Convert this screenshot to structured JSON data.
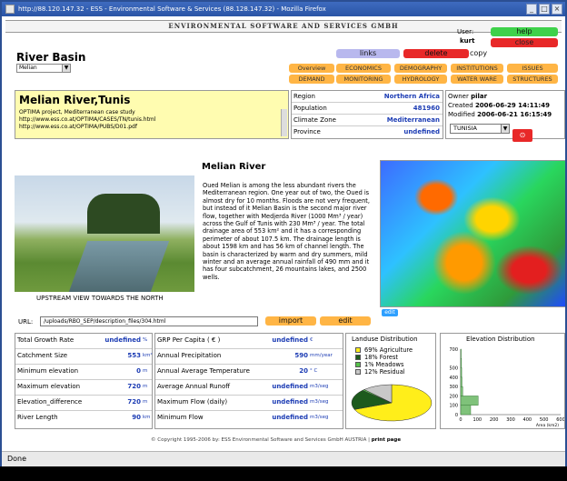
{
  "window": {
    "title": "http://88.120.147.32 - ESS - Environmental Software & Services (88.128.147.32) - Mozilla Firefox",
    "status": "Done"
  },
  "header": {
    "company": "ENVIRONMENTAL SOFTWARE AND SERVICES GMBH",
    "user_label": "User:",
    "user": "kurt"
  },
  "buttons": {
    "help": "help",
    "close": "close",
    "links": "links",
    "delete": "delete",
    "copy": "copy",
    "save": "save",
    "import": "import",
    "edit": "edit",
    "map_edit": "edit"
  },
  "page": {
    "title": "River Basin",
    "basin_select": "Melian"
  },
  "nav": {
    "row1": [
      "Overview",
      "ECONOMICS",
      "DEMOGRAPHY",
      "INSTITUTIONS",
      "ISSUES"
    ],
    "row2": [
      "DEMAND",
      "MONITORING",
      "HYDROLOGY",
      "WATER WARE",
      "STRUCTURES"
    ]
  },
  "basin": {
    "name": "Melian River,Tunis",
    "desc_lines": [
      "OPTIMA project, Mediterranean case study",
      "http://www.ess.co.at/OPTIMA/CASES/TN/tunis.html",
      "http://www.ess.co.at/OPTIMA/PUBS/D01.pdf"
    ],
    "info": [
      {
        "label": "Region",
        "value": "Northern Africa"
      },
      {
        "label": "Population",
        "value": "481960"
      },
      {
        "label": "Climate Zone",
        "value": "Mediterranean"
      },
      {
        "label": "Province",
        "value": "undefined"
      }
    ],
    "owner_label": "Owner",
    "owner": "pilar",
    "created_label": "Created",
    "created": "2006-06-29 14:11:49",
    "modified_label": "Modified",
    "modified": "2006-06-21 16:15:49",
    "country": "TUNISIA"
  },
  "description": {
    "title": "Melian River",
    "body": "Oued Melian is among the less abundant rivers the Mediterranean region. One year out of two, the Oued is almost dry for 10 months. Floods are not very frequent, but instead of it Melian Basin is the second major river flow, together with Medjerda River (1000 Mm³ / year) across the Gulf of Tunis with 230 Mm³ / year. The total drainage area of 553 km² and it has a corresponding perimeter of about 107.5 km. The drainage length is about 1598 km and has 56 km of channel length. The basin is characterized by warm and dry summers, mild winter and an average annual rainfall of 490 mm and it has four subcatchment, 26 mountains lakes, and 2500 wells.",
    "photo_caption": "UPSTREAM VIEW TOWARDS THE NORTH"
  },
  "url": {
    "label": "URL:",
    "value": "/uploads/RBO_SEP/description_files/304.html"
  },
  "stats_left": [
    {
      "label": "Total Growth Rate",
      "value": "undefined",
      "unit": "%"
    },
    {
      "label": "Catchment Size",
      "value": "553",
      "unit": "km²"
    },
    {
      "label": "Minimum elevation",
      "value": "0",
      "unit": "m"
    },
    {
      "label": "Maximum elevation",
      "value": "720",
      "unit": "m"
    },
    {
      "label": "Elevation_difference",
      "value": "720",
      "unit": "m"
    },
    {
      "label": "River Length",
      "value": "90",
      "unit": "km"
    }
  ],
  "stats_right": [
    {
      "label": "GRP Per Capita ( € )",
      "value": "undefined",
      "unit": "€"
    },
    {
      "label": "Annual Precipitation",
      "value": "590",
      "unit": "mm/year"
    },
    {
      "label": "Annual Average Temperature",
      "value": "20",
      "unit": "° C"
    },
    {
      "label": "Average Annual Runoff",
      "value": "undefined",
      "unit": "m3/seg"
    },
    {
      "label": "Maximum Flow (daily)",
      "value": "undefined",
      "unit": "m3/seg"
    },
    {
      "label": "Minimum Flow",
      "value": "undefined",
      "unit": "m3/seg"
    }
  ],
  "landuse": {
    "title": "Landuse Distribution",
    "items": [
      {
        "label": "69% Agriculture",
        "color": "#ffee1a"
      },
      {
        "label": "18% Forest",
        "color": "#1d5a1d"
      },
      {
        "label": "1% Meadows",
        "color": "#55c24a"
      },
      {
        "label": "12% Residual",
        "color": "#c8c8c8"
      }
    ]
  },
  "elevation": {
    "title": "Elevation Distribution",
    "y_ticks": [
      "700",
      "500",
      "400",
      "300",
      "200",
      "100",
      "0"
    ],
    "x_ticks": [
      "0",
      "100",
      "200",
      "300",
      "400",
      "500",
      "600"
    ],
    "x_unit": "Area (km2)"
  },
  "footer": {
    "text": "© Copyright 1995-2006 by:  ESS  Environmental Software and Services GmbH AUSTRIA",
    "print": "print page"
  },
  "chart_data": [
    {
      "type": "pie",
      "title": "Landuse Distribution",
      "categories": [
        "Agriculture",
        "Forest",
        "Meadows",
        "Residual"
      ],
      "values": [
        69,
        18,
        1,
        12
      ]
    },
    {
      "type": "bar",
      "title": "Elevation Distribution",
      "orientation": "horizontal",
      "categories": [
        "0-100",
        "100-200",
        "200-300",
        "300-400",
        "400-500",
        "500-600",
        "600-700"
      ],
      "values": [
        60,
        105,
        12,
        8,
        6,
        5,
        3
      ],
      "ylim": [
        0,
        700
      ],
      "xlim": [
        0,
        600
      ],
      "xlabel": "Area (km2)"
    }
  ]
}
